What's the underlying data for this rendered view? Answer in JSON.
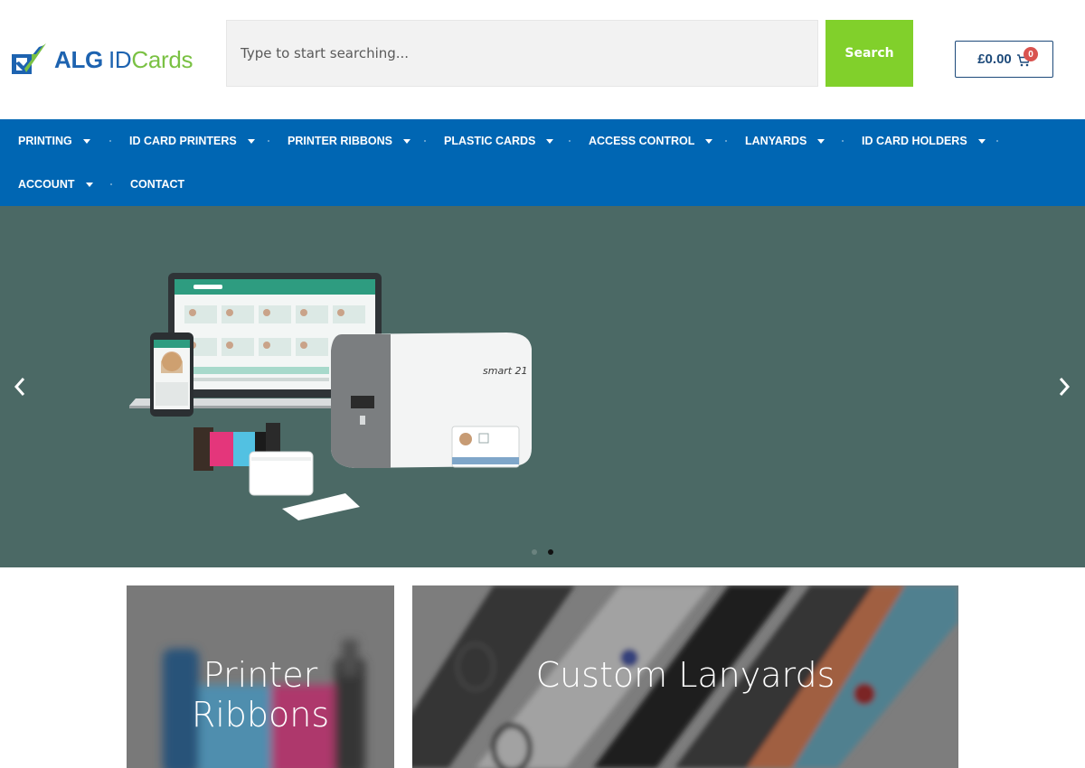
{
  "brand": {
    "logo_text_1": "ALG",
    "logo_text_2": "ID",
    "logo_text_3": "Cards",
    "primary_color": "#1d63b0",
    "accent_color": "#7ac143"
  },
  "search": {
    "placeholder": "Type to start searching...",
    "button_label": "Search",
    "button_color": "#81d02b"
  },
  "cart": {
    "amount": "£0.00",
    "count": "0",
    "icon": "cart-icon"
  },
  "nav": {
    "color": "#0066b3",
    "items": [
      {
        "label": "PRINTING",
        "has_dropdown": true
      },
      {
        "label": "ID CARD PRINTERS",
        "has_dropdown": true
      },
      {
        "label": "PRINTER RIBBONS",
        "has_dropdown": true
      },
      {
        "label": "PLASTIC CARDS",
        "has_dropdown": true
      },
      {
        "label": "ACCESS CONTROL",
        "has_dropdown": true
      },
      {
        "label": "LANYARDS",
        "has_dropdown": true
      },
      {
        "label": "ID CARD HOLDERS",
        "has_dropdown": true
      },
      {
        "label": "ACCOUNT",
        "has_dropdown": true
      },
      {
        "label": "CONTACT",
        "has_dropdown": false
      }
    ]
  },
  "hero": {
    "background": "#4b6965",
    "printer_label": "smart 21",
    "prev_icon": "chevron-left-icon",
    "next_icon": "chevron-right-icon",
    "slides": 2,
    "active_slide": 2
  },
  "tiles": [
    {
      "title_line_1": "Printer",
      "title_line_2": "Ribbons"
    },
    {
      "title": "Custom Lanyards"
    }
  ]
}
